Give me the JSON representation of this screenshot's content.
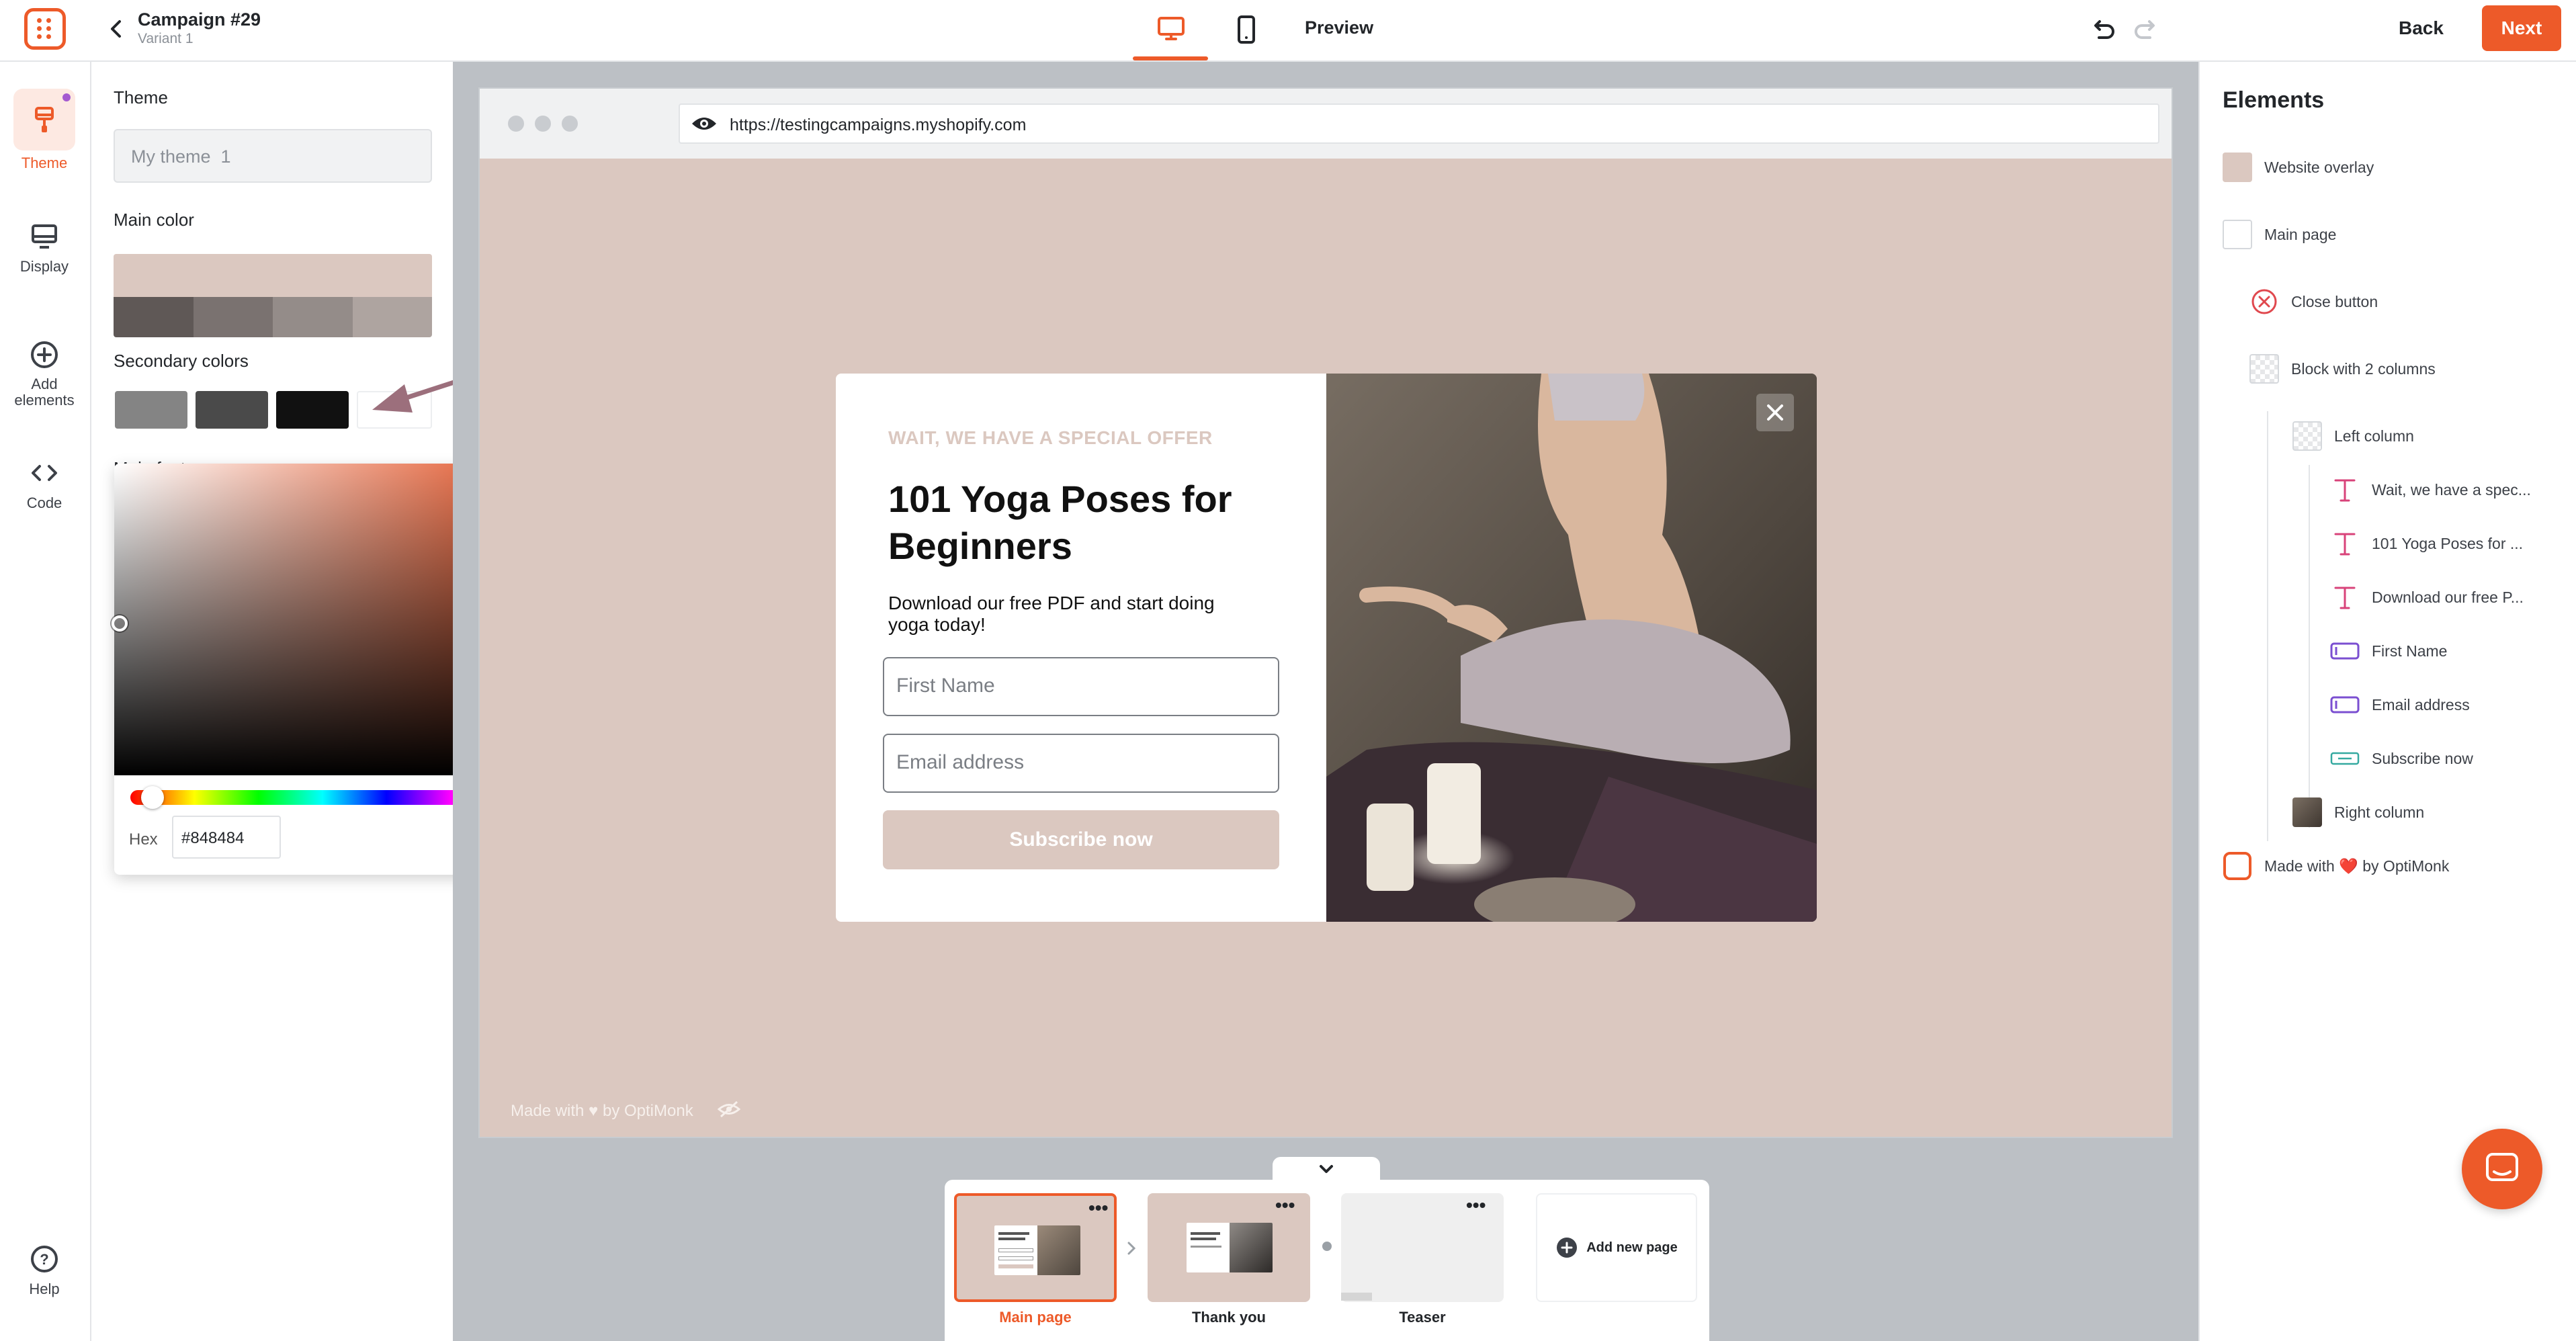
{
  "topbar": {
    "campaign_title": "Campaign #29",
    "variant": "Variant 1",
    "preview_label": "Preview",
    "back_label": "Back",
    "next_label": "Next"
  },
  "rail": {
    "items": [
      {
        "label": "Theme",
        "icon": "brush-icon",
        "active": true
      },
      {
        "label": "Display",
        "icon": "monitor-icon"
      },
      {
        "label": "Add elements",
        "icon": "plus-circle-icon"
      },
      {
        "label": "Code",
        "icon": "code-icon"
      }
    ],
    "help_label": "Help"
  },
  "theme_panel": {
    "theme_heading": "Theme",
    "theme_name": "My theme  1",
    "main_color_heading": "Main color",
    "main_color": "#dbc8c0",
    "main_shades": [
      "#5f5856",
      "#7a7270",
      "#948c89",
      "#aea4a0"
    ],
    "secondary_heading": "Secondary colors",
    "secondary_colors": [
      "#848484",
      "#4a4a4a",
      "#111111",
      "#ffffff"
    ],
    "covered_heading": "Main font"
  },
  "picker": {
    "hex_label": "Hex",
    "hex_value": "#848484"
  },
  "browser": {
    "url": "https://testingcampaigns.myshopify.com",
    "footer_text": "Made with ♥ by OptiMonk"
  },
  "popup": {
    "eyebrow": "WAIT, WE HAVE A SPECIAL OFFER",
    "headline": "101 Yoga Poses for Beginners",
    "description": "Download our free PDF and start doing yoga today!",
    "first_name_placeholder": "First Name",
    "email_placeholder": "Email address",
    "button_label": "Subscribe now",
    "accent": "#dbc8c0"
  },
  "elements_panel": {
    "heading": "Elements",
    "items": [
      {
        "label": "Website overlay",
        "icon": "color-square-icon"
      },
      {
        "label": "Main page",
        "icon": "white-square-icon"
      },
      {
        "label": "Close button",
        "icon": "close-circle-icon"
      },
      {
        "label": "Block with 2 columns",
        "icon": "checker-icon"
      },
      {
        "label": "Left column",
        "icon": "checker-icon"
      },
      {
        "label": "Wait, we have a spec...",
        "icon": "text-icon"
      },
      {
        "label": "101 Yoga Poses for ...",
        "icon": "text-icon"
      },
      {
        "label": "Download our free P...",
        "icon": "text-icon"
      },
      {
        "label": "First Name",
        "icon": "input-icon"
      },
      {
        "label": "Email address",
        "icon": "input-icon"
      },
      {
        "label": "Subscribe now",
        "icon": "button-icon"
      },
      {
        "label": "Right column",
        "icon": "image-icon"
      },
      {
        "label": "Made with ❤️ by OptiMonk",
        "icon": "optimonk-logo-icon"
      }
    ]
  },
  "pages": [
    {
      "label": "Main page",
      "active": true
    },
    {
      "label": "Thank you"
    },
    {
      "label": "Teaser"
    }
  ],
  "add_page_label": "Add new page",
  "colors": {
    "brand": "#ed5a29",
    "brand_dark": "#d9531e",
    "accent_purple": "#7b4fd1",
    "pink_icon": "#d8437a"
  }
}
